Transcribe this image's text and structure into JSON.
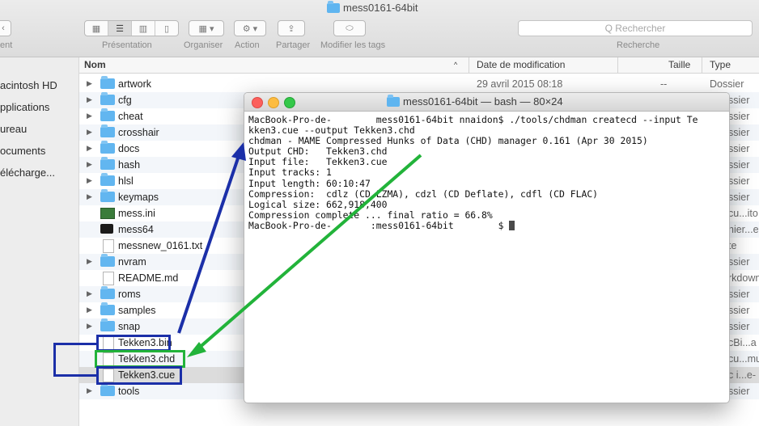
{
  "window": {
    "title": "mess0161-64bit"
  },
  "toolbar": {
    "back_label": "ent",
    "presentation_label": "Présentation",
    "organize_label": "Organiser",
    "action_label": "Action",
    "share_label": "Partager",
    "tags_label": "Modifier les tags",
    "search_placeholder": "Q Rechercher",
    "search_label": "Recherche"
  },
  "sidebar": {
    "items": [
      {
        "label": "acintosh HD"
      },
      {
        "label": "pplications"
      },
      {
        "label": "ureau"
      },
      {
        "label": "ocuments"
      },
      {
        "label": "élécharge..."
      }
    ]
  },
  "columns": {
    "name": "Nom",
    "date": "Date de modification",
    "size": "Taille",
    "kind": "Type"
  },
  "files": [
    {
      "name": "artwork",
      "date": "29 avril 2015 08:18",
      "size": "--",
      "kind": "Dossier"
    },
    {
      "name": "cfg",
      "kind": "ssier"
    },
    {
      "name": "cheat",
      "kind": "ssier"
    },
    {
      "name": "crosshair",
      "kind": "ssier"
    },
    {
      "name": "docs",
      "kind": "ssier"
    },
    {
      "name": "hash",
      "kind": "ssier"
    },
    {
      "name": "hlsl",
      "kind": "ssier"
    },
    {
      "name": "keymaps",
      "kind": "ssier"
    },
    {
      "name": "mess.ini",
      "kind": "cu...ito"
    },
    {
      "name": "mess64",
      "kind": "hier...e"
    },
    {
      "name": "messnew_0161.txt",
      "kind": "te"
    },
    {
      "name": "nvram",
      "kind": "ssier"
    },
    {
      "name": "README.md",
      "kind": "rkdown"
    },
    {
      "name": "roms",
      "kind": "ssier"
    },
    {
      "name": "samples",
      "kind": "ssier"
    },
    {
      "name": "snap",
      "kind": "ssier"
    },
    {
      "name": "Tekken3.bin",
      "kind": "cBi...a"
    },
    {
      "name": "Tekken3.chd",
      "kind": "cu...mu"
    },
    {
      "name": "Tekken3.cue",
      "kind": "c i...e-"
    },
    {
      "name": "tools",
      "kind": "ssier"
    }
  ],
  "terminal": {
    "title": "mess0161-64bit — bash — 80×24",
    "lines": [
      "MacBook-Pro-de-        mess0161-64bit nnaidon$ ./tools/chdman createcd --input Te",
      "kken3.cue --output Tekken3.chd",
      "chdman - MAME Compressed Hunks of Data (CHD) manager 0.161 (Apr 30 2015)",
      "Output CHD:   Tekken3.chd",
      "Input file:   Tekken3.cue",
      "Input tracks: 1",
      "Input length: 60:10:47",
      "Compression:  cdlz (CD LZMA), cdzl (CD Deflate), cdfl (CD FLAC)",
      "Logical size: 662,918,400",
      "Compression complete ... final ratio = 66.8%"
    ],
    "prompt": "MacBook-Pro-de-       :mess0161-64bit        $ "
  },
  "colors": {
    "blue_annotation": "#1b2fa8",
    "green_annotation": "#22b33a",
    "folder": "#62b6f0"
  }
}
